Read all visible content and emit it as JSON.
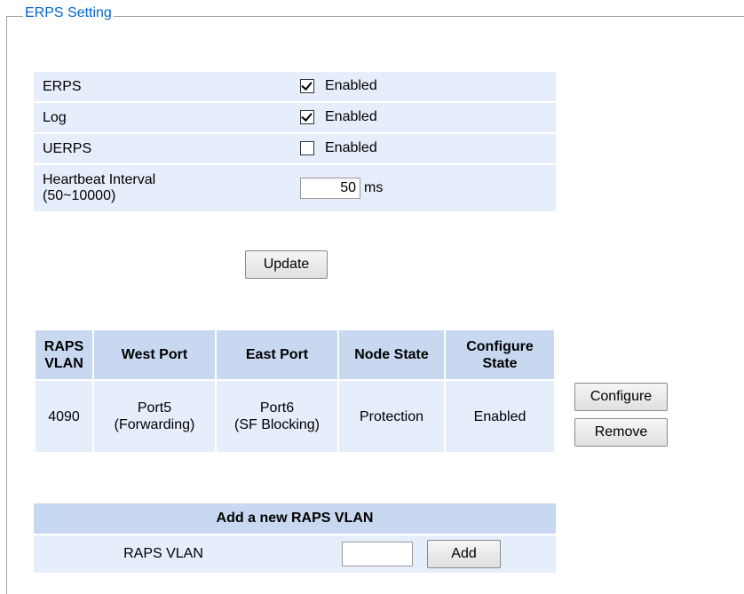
{
  "legend": "ERPS Setting",
  "settings": [
    {
      "label": "ERPS",
      "checked": true,
      "text": "Enabled"
    },
    {
      "label": "Log",
      "checked": true,
      "text": "Enabled"
    },
    {
      "label": "UERPS",
      "checked": false,
      "text": "Enabled"
    }
  ],
  "heartbeat": {
    "label_line1": "Heartbeat Interval",
    "label_line2": "(50~10000)",
    "value": "50",
    "unit": "ms"
  },
  "update_label": "Update",
  "raps_table": {
    "headers": {
      "vlan_1": "RAPS",
      "vlan_2": "VLAN",
      "west": "West Port",
      "east": "East Port",
      "node": "Node State",
      "conf_1": "Configure",
      "conf_2": "State"
    },
    "row": {
      "vlan": "4090",
      "west_1": "Port5",
      "west_2": "(Forwarding)",
      "east_1": "Port6",
      "east_2": "(SF Blocking)",
      "node": "Protection",
      "conf": "Enabled"
    }
  },
  "configure_label": "Configure",
  "remove_label": "Remove",
  "add_section": {
    "title": "Add a new RAPS VLAN",
    "label": "RAPS VLAN",
    "input_value": "",
    "add_label": "Add"
  }
}
